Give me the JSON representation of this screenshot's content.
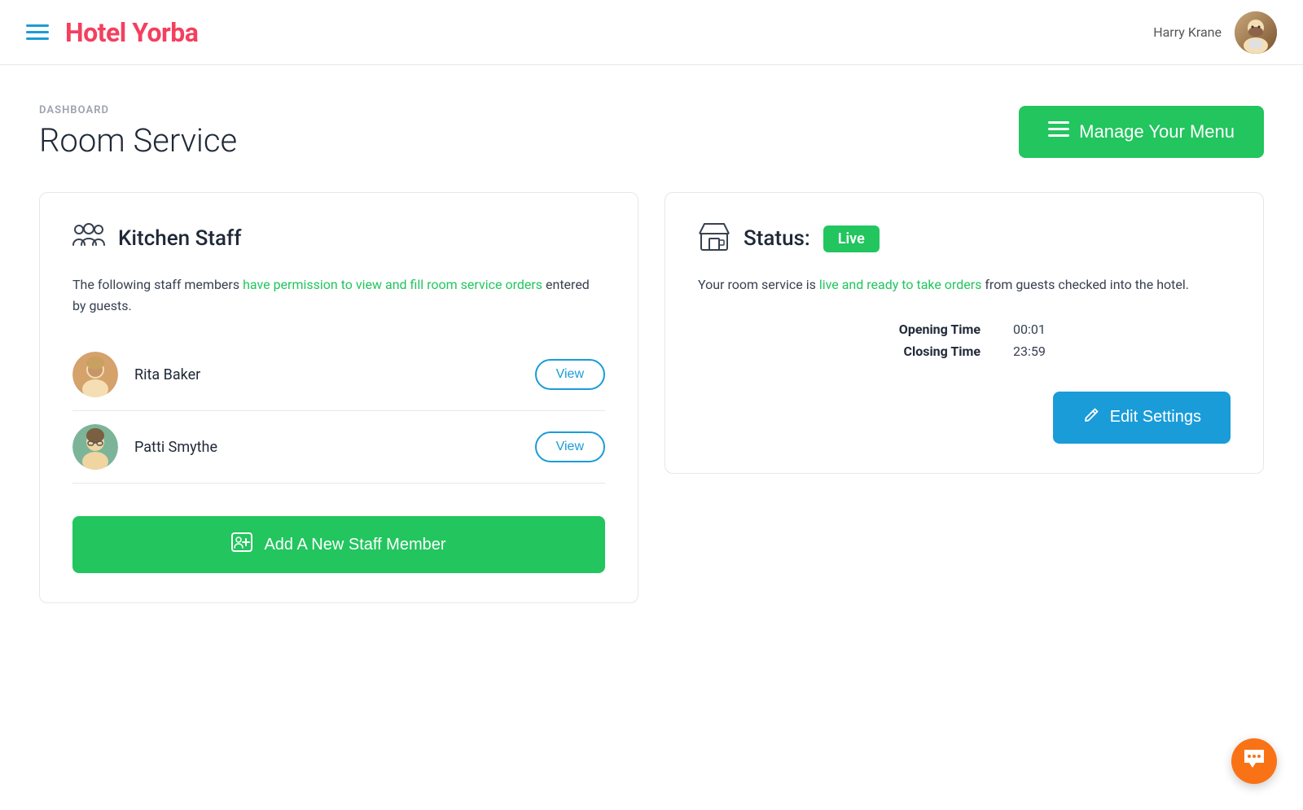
{
  "header": {
    "logo": "Hotel Yorba",
    "user_name": "Harry Krane",
    "avatar_emoji": "👨‍🍳"
  },
  "page": {
    "breadcrumb": "DASHBOARD",
    "title": "Room Service",
    "manage_menu_label": "Manage Your Menu"
  },
  "kitchen_staff_card": {
    "title": "Kitchen Staff",
    "description_prefix": "The following staff members ",
    "description_green": "have permission to view and fill room service orders",
    "description_suffix": " entered by guests.",
    "staff": [
      {
        "name": "Rita Baker",
        "view_label": "View",
        "avatar_emoji": "👩"
      },
      {
        "name": "Patti Smythe",
        "view_label": "View",
        "avatar_emoji": "👩‍🦰"
      }
    ],
    "add_staff_label": "Add A New Staff Member"
  },
  "status_card": {
    "title": "Status:",
    "status_badge": "Live",
    "description_prefix": "Your room service is ",
    "description_green": "live and ready to take orders",
    "description_suffix": " from guests checked into the hotel.",
    "opening_time_label": "Opening Time",
    "opening_time_value": "00:01",
    "closing_time_label": "Closing Time",
    "closing_time_value": "23:59",
    "edit_settings_label": "Edit Settings"
  },
  "chat": {
    "icon": "💬"
  }
}
